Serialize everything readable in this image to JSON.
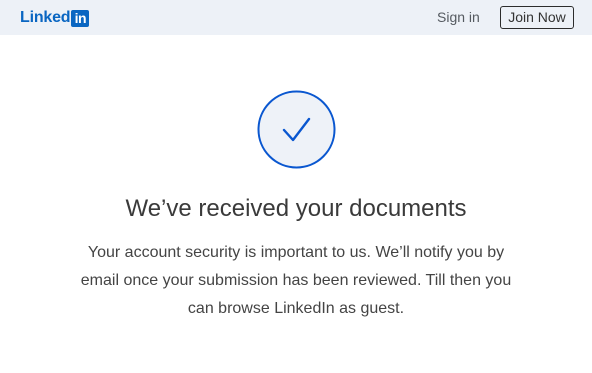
{
  "header": {
    "logo_text": "Linked",
    "logo_box_text": "in",
    "sign_in_label": "Sign in",
    "join_now_label": "Join Now"
  },
  "main": {
    "status_icon": "checkmark-circle-icon",
    "title": "We’ve received your documents",
    "message": "Your account security is important to us. We’ll notify you by email once your submission has been reviewed. Till then you can browse LinkedIn as guest."
  },
  "colors": {
    "header_bg": "#edf1f7",
    "brand_blue": "#0a66c2",
    "icon_blue": "#0a57d0",
    "icon_fill": "#eef2f8"
  }
}
